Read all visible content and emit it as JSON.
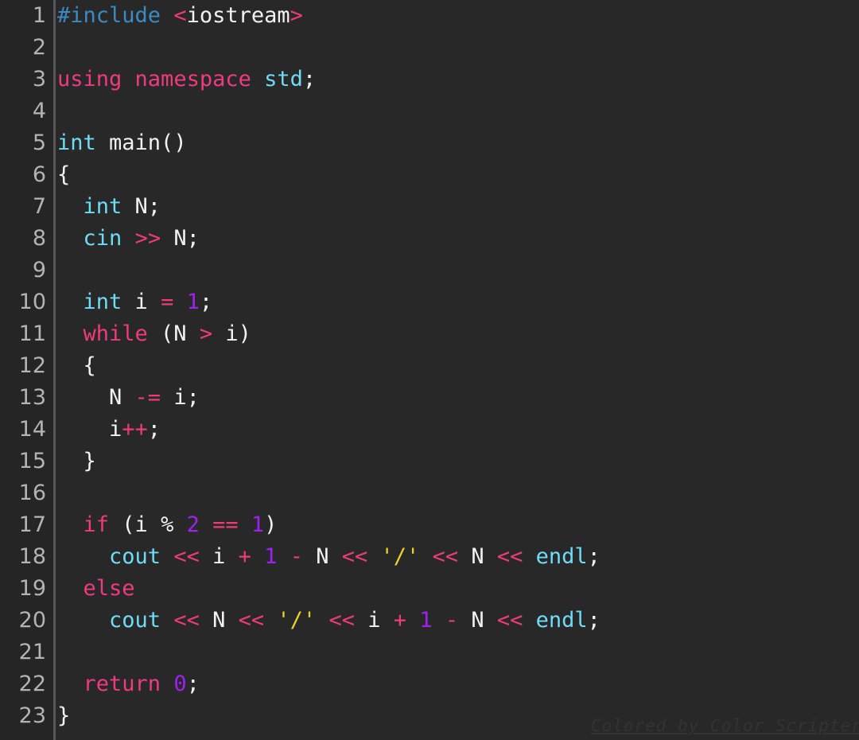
{
  "editor": {
    "language": "C++",
    "background_color": "#282828",
    "gutter_color": "#252525",
    "gutter_rule_color": "#575757",
    "line_number_color": "#b3b3b3",
    "line_height_px": 40,
    "font_size_px": 27,
    "total_lines": 23
  },
  "palette": {
    "preprocessor": "#3b8ac4",
    "keyword": "#ef3b7d",
    "type": "#6fdcf7",
    "number": "#a020f0",
    "string": "#f2d027",
    "operator": "#ef3b7d",
    "plain": "#f2f2f2"
  },
  "watermark": {
    "text": "Colored by Color Scripter"
  },
  "lines": [
    {
      "number": "1",
      "text": "#include <iostream>",
      "tokens": [
        {
          "text": "#include",
          "kind": "pre"
        },
        {
          "text": " ",
          "kind": "plain"
        },
        {
          "text": "<",
          "kind": "op"
        },
        {
          "text": "iostream",
          "kind": "plain"
        },
        {
          "text": ">",
          "kind": "op"
        }
      ]
    },
    {
      "number": "2",
      "text": "",
      "tokens": []
    },
    {
      "number": "3",
      "text": "using namespace std;",
      "tokens": [
        {
          "text": "using",
          "kind": "key"
        },
        {
          "text": " ",
          "kind": "plain"
        },
        {
          "text": "namespace",
          "kind": "key"
        },
        {
          "text": " ",
          "kind": "plain"
        },
        {
          "text": "std",
          "kind": "type"
        },
        {
          "text": ";",
          "kind": "plain"
        }
      ]
    },
    {
      "number": "4",
      "text": "",
      "tokens": []
    },
    {
      "number": "5",
      "text": "int main()",
      "tokens": [
        {
          "text": "int",
          "kind": "type"
        },
        {
          "text": " main()",
          "kind": "plain"
        }
      ]
    },
    {
      "number": "6",
      "text": "{",
      "tokens": [
        {
          "text": "{",
          "kind": "plain"
        }
      ]
    },
    {
      "number": "7",
      "text": "  int N;",
      "tokens": [
        {
          "text": "  ",
          "kind": "plain"
        },
        {
          "text": "int",
          "kind": "type"
        },
        {
          "text": " N;",
          "kind": "plain"
        }
      ]
    },
    {
      "number": "8",
      "text": "  cin >> N;",
      "tokens": [
        {
          "text": "  ",
          "kind": "plain"
        },
        {
          "text": "cin",
          "kind": "type"
        },
        {
          "text": " ",
          "kind": "plain"
        },
        {
          "text": ">>",
          "kind": "op"
        },
        {
          "text": " N;",
          "kind": "plain"
        }
      ]
    },
    {
      "number": "9",
      "text": "",
      "tokens": []
    },
    {
      "number": "10",
      "text": "  int i = 1;",
      "tokens": [
        {
          "text": "  ",
          "kind": "plain"
        },
        {
          "text": "int",
          "kind": "type"
        },
        {
          "text": " i ",
          "kind": "plain"
        },
        {
          "text": "=",
          "kind": "op"
        },
        {
          "text": " ",
          "kind": "plain"
        },
        {
          "text": "1",
          "kind": "num"
        },
        {
          "text": ";",
          "kind": "plain"
        }
      ]
    },
    {
      "number": "11",
      "text": "  while (N > i)",
      "tokens": [
        {
          "text": "  ",
          "kind": "plain"
        },
        {
          "text": "while",
          "kind": "key"
        },
        {
          "text": " (N ",
          "kind": "plain"
        },
        {
          "text": ">",
          "kind": "op"
        },
        {
          "text": " i)",
          "kind": "plain"
        }
      ]
    },
    {
      "number": "12",
      "text": "  {",
      "tokens": [
        {
          "text": "  {",
          "kind": "plain"
        }
      ]
    },
    {
      "number": "13",
      "text": "    N -= i;",
      "tokens": [
        {
          "text": "    N ",
          "kind": "plain"
        },
        {
          "text": "-=",
          "kind": "op"
        },
        {
          "text": " i;",
          "kind": "plain"
        }
      ]
    },
    {
      "number": "14",
      "text": "    i++;",
      "tokens": [
        {
          "text": "    i",
          "kind": "plain"
        },
        {
          "text": "++",
          "kind": "op"
        },
        {
          "text": ";",
          "kind": "plain"
        }
      ]
    },
    {
      "number": "15",
      "text": "  }",
      "tokens": [
        {
          "text": "  }",
          "kind": "plain"
        }
      ]
    },
    {
      "number": "16",
      "text": "",
      "tokens": []
    },
    {
      "number": "17",
      "text": "  if (i % 2 == 1)",
      "tokens": [
        {
          "text": "  ",
          "kind": "plain"
        },
        {
          "text": "if",
          "kind": "key"
        },
        {
          "text": " (i ",
          "kind": "plain"
        },
        {
          "text": "%",
          "kind": "plain"
        },
        {
          "text": " ",
          "kind": "plain"
        },
        {
          "text": "2",
          "kind": "num"
        },
        {
          "text": " ",
          "kind": "plain"
        },
        {
          "text": "==",
          "kind": "op"
        },
        {
          "text": " ",
          "kind": "plain"
        },
        {
          "text": "1",
          "kind": "num"
        },
        {
          "text": ")",
          "kind": "plain"
        }
      ]
    },
    {
      "number": "18",
      "text": "    cout << i + 1 - N << '/' << N << endl;",
      "tokens": [
        {
          "text": "    ",
          "kind": "plain"
        },
        {
          "text": "cout",
          "kind": "type"
        },
        {
          "text": " ",
          "kind": "plain"
        },
        {
          "text": "<<",
          "kind": "op"
        },
        {
          "text": " i ",
          "kind": "plain"
        },
        {
          "text": "+",
          "kind": "op"
        },
        {
          "text": " ",
          "kind": "plain"
        },
        {
          "text": "1",
          "kind": "num"
        },
        {
          "text": " ",
          "kind": "plain"
        },
        {
          "text": "-",
          "kind": "op"
        },
        {
          "text": " N ",
          "kind": "plain"
        },
        {
          "text": "<<",
          "kind": "op"
        },
        {
          "text": " ",
          "kind": "plain"
        },
        {
          "text": "'/'",
          "kind": "str"
        },
        {
          "text": " ",
          "kind": "plain"
        },
        {
          "text": "<<",
          "kind": "op"
        },
        {
          "text": " N ",
          "kind": "plain"
        },
        {
          "text": "<<",
          "kind": "op"
        },
        {
          "text": " ",
          "kind": "plain"
        },
        {
          "text": "endl",
          "kind": "type"
        },
        {
          "text": ";",
          "kind": "plain"
        }
      ]
    },
    {
      "number": "19",
      "text": "  else",
      "tokens": [
        {
          "text": "  ",
          "kind": "plain"
        },
        {
          "text": "else",
          "kind": "key"
        }
      ]
    },
    {
      "number": "20",
      "text": "    cout << N << '/' << i + 1 - N << endl;",
      "tokens": [
        {
          "text": "    ",
          "kind": "plain"
        },
        {
          "text": "cout",
          "kind": "type"
        },
        {
          "text": " ",
          "kind": "plain"
        },
        {
          "text": "<<",
          "kind": "op"
        },
        {
          "text": " N ",
          "kind": "plain"
        },
        {
          "text": "<<",
          "kind": "op"
        },
        {
          "text": " ",
          "kind": "plain"
        },
        {
          "text": "'/'",
          "kind": "str"
        },
        {
          "text": " ",
          "kind": "plain"
        },
        {
          "text": "<<",
          "kind": "op"
        },
        {
          "text": " i ",
          "kind": "plain"
        },
        {
          "text": "+",
          "kind": "op"
        },
        {
          "text": " ",
          "kind": "plain"
        },
        {
          "text": "1",
          "kind": "num"
        },
        {
          "text": " ",
          "kind": "plain"
        },
        {
          "text": "-",
          "kind": "op"
        },
        {
          "text": " N ",
          "kind": "plain"
        },
        {
          "text": "<<",
          "kind": "op"
        },
        {
          "text": " ",
          "kind": "plain"
        },
        {
          "text": "endl",
          "kind": "type"
        },
        {
          "text": ";",
          "kind": "plain"
        }
      ]
    },
    {
      "number": "21",
      "text": "",
      "tokens": []
    },
    {
      "number": "22",
      "text": "  return 0;",
      "tokens": [
        {
          "text": "  ",
          "kind": "plain"
        },
        {
          "text": "return",
          "kind": "key"
        },
        {
          "text": " ",
          "kind": "plain"
        },
        {
          "text": "0",
          "kind": "num"
        },
        {
          "text": ";",
          "kind": "plain"
        }
      ]
    },
    {
      "number": "23",
      "text": "}",
      "tokens": [
        {
          "text": "}",
          "kind": "plain"
        }
      ]
    }
  ]
}
